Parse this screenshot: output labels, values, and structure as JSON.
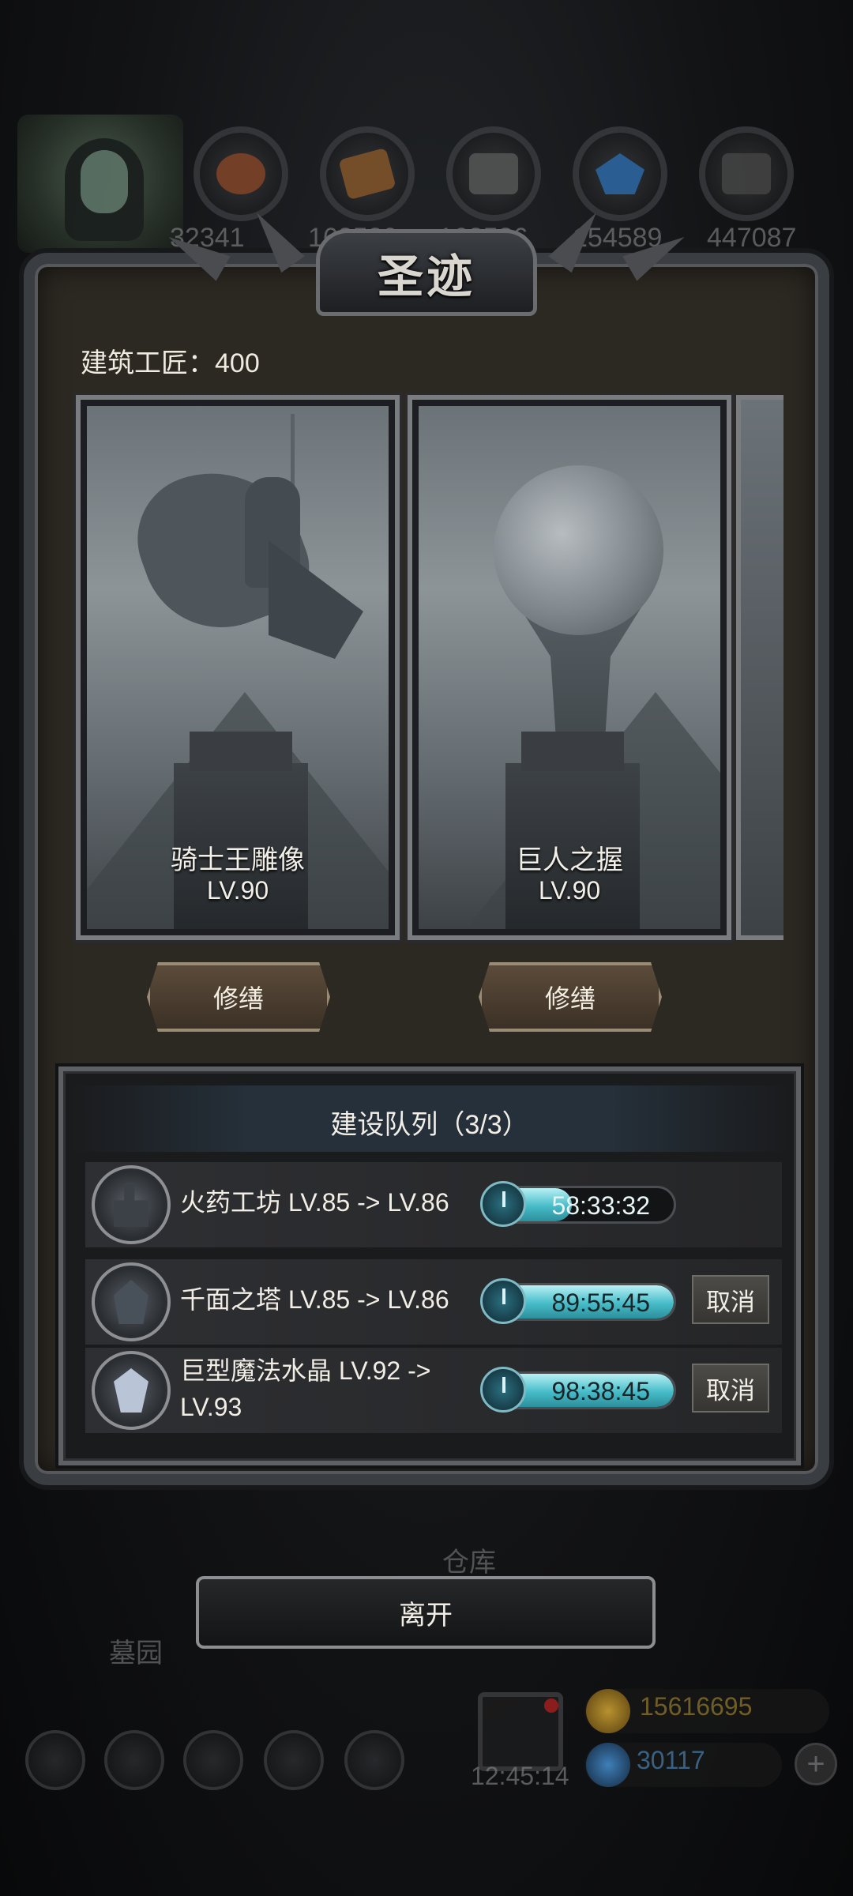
{
  "top_bar": {
    "resources": [
      {
        "icon": "meat-icon",
        "value": "32341",
        "color": "#8a4a2a"
      },
      {
        "icon": "wood-icon",
        "value": "168580",
        "color": "#8b5a2b"
      },
      {
        "icon": "stone-icon",
        "value": "168586",
        "color": "#5a5a5a"
      },
      {
        "icon": "crystal-icon",
        "value": "154589",
        "color": "#2f6fb0"
      },
      {
        "icon": "iron-icon",
        "value": "447087",
        "color": "#4a4a4a"
      }
    ]
  },
  "dialog": {
    "title": "圣迹",
    "builder_label": "建筑工匠：400",
    "monuments": [
      {
        "name": "骑士王雕像",
        "level": "LV.90",
        "button": "修缮"
      },
      {
        "name": "巨人之握",
        "level": "LV.90",
        "button": "修缮"
      }
    ],
    "queue": {
      "title": "建设队列（3/3）",
      "items": [
        {
          "icon": "workshop-icon",
          "text": "火药工坊 LV.85 -> LV.86",
          "time": "58:33:32",
          "progress": 0.45,
          "cancel": ""
        },
        {
          "icon": "tower-icon",
          "text": "千面之塔 LV.85 -> LV.86",
          "time": "89:55:45",
          "progress": 1.0,
          "cancel": "取消"
        },
        {
          "icon": "crystal-icon",
          "text_line1": "巨型魔法水晶 LV.92 ->",
          "text_line2": "LV.93",
          "time": "98:38:45",
          "progress": 1.0,
          "cancel": "取消"
        }
      ]
    },
    "leave_button": "离开"
  },
  "background": {
    "warehouse_label": "仓库",
    "cemetery_label": "墓园",
    "clock": "12:45:14",
    "gold": "15616695",
    "gems": "30117"
  }
}
